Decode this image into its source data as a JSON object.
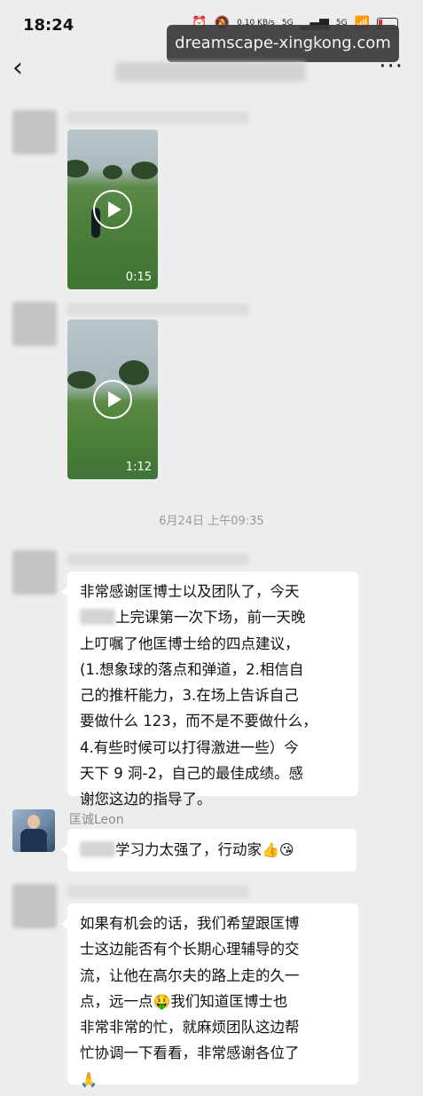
{
  "status_bar": {
    "time": "18:24",
    "net_speed": "0.10\nKB/s",
    "sim1": "5G",
    "sim2": "5G",
    "battery_level": 0.15,
    "icons": [
      "alarm-icon",
      "mute-icon",
      "signal-icon",
      "wifi-icon",
      "battery-icon"
    ]
  },
  "watermark": "dreamscape-xingkong.com",
  "nav": {
    "back_glyph": "‹",
    "more_glyph": "···",
    "title_redacted": true
  },
  "messages": [
    {
      "type": "video",
      "sender_redacted": true,
      "duration": "0:15"
    },
    {
      "type": "video",
      "sender_redacted": true,
      "duration": "1:12"
    },
    {
      "type": "timestamp",
      "text": "6月24日 上午09:35"
    },
    {
      "type": "text",
      "sender_redacted": true,
      "lines": [
        "非常感谢匡博士以及团队了，今天",
        "上完课第一次下场，前一天晚",
        "上叮嘱了他匡博士给的四点建议，",
        "(1.想象球的落点和弹道，2.相信自",
        "己的推杆能力，3.在场上告诉自己",
        "要做什么 123，而不是不要做什么，",
        "4.有些时候可以打得激进一些）今",
        "天下 9 洞-2，自己的最佳成绩。感",
        "谢您这边的指导了。"
      ]
    },
    {
      "type": "text",
      "sender": "匡诚Leon",
      "text": "学习力太强了，行动家",
      "emoji": "👍😘"
    },
    {
      "type": "text",
      "sender_redacted": true,
      "lines": [
        "如果有机会的话，我们希望跟匡博",
        "士这边能否有个长期心理辅导的交",
        "流，让他在高尔夫的路上走的久一",
        "点，远一点",
        "我们知道匡博士也",
        "非常非常的忙，就麻烦团队这边帮",
        "忙协调一下看看，非常感谢各位了"
      ],
      "emoji_inline": "🤑",
      "emoji_end": "🙏"
    }
  ]
}
